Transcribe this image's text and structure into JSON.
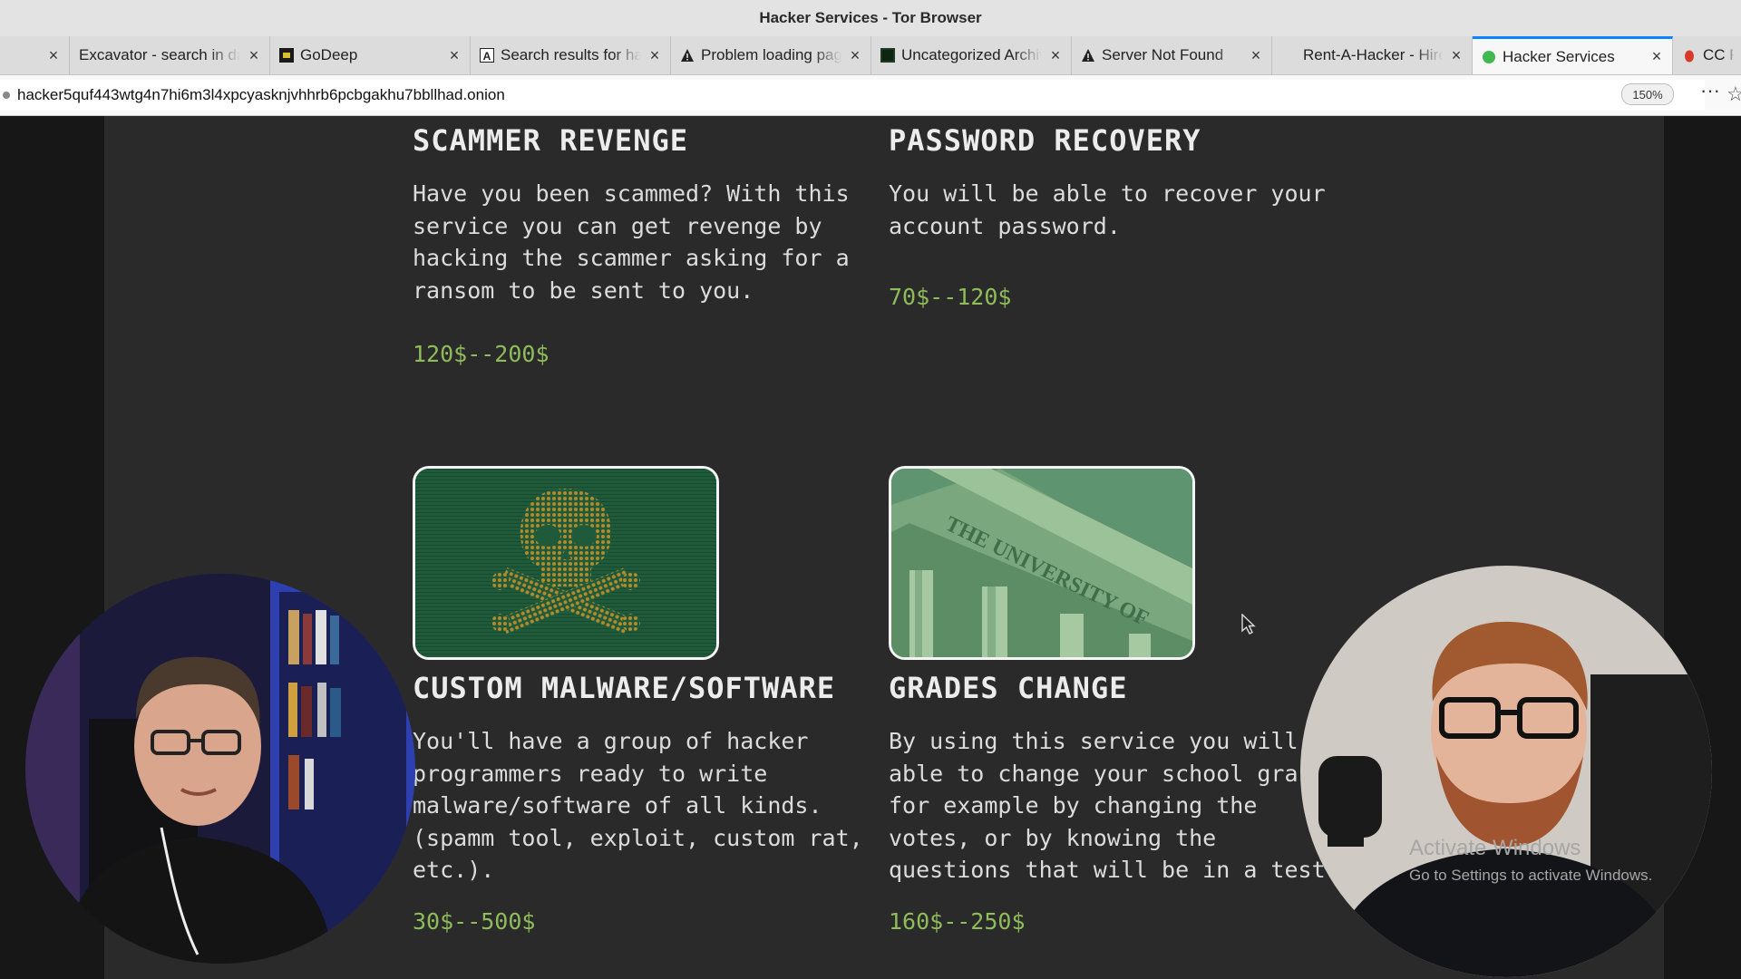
{
  "window": {
    "title": "Hacker Services - Tor Browser"
  },
  "tabs": [
    {
      "label": "",
      "favicon": "none",
      "active": false
    },
    {
      "label": "Excavator - search in dark web",
      "favicon": "none",
      "active": false
    },
    {
      "label": "GoDeep",
      "favicon": "godeep-icon",
      "active": false
    },
    {
      "label": "Search results for hacker",
      "favicon": "letter-a-icon",
      "active": false
    },
    {
      "label": "Problem loading page",
      "favicon": "warning-icon",
      "active": false
    },
    {
      "label": "Uncategorized Archives",
      "favicon": "dark-square-icon",
      "active": false
    },
    {
      "label": "Server Not Found",
      "favicon": "warning-icon",
      "active": false
    },
    {
      "label": "Rent-A-Hacker - Hire",
      "favicon": "none",
      "active": false
    },
    {
      "label": "Hacker Services",
      "favicon": "green-dot-icon",
      "active": true
    },
    {
      "label": "CC F",
      "favicon": "red-icon",
      "active": false
    }
  ],
  "tab_close_glyph": "×",
  "address_bar": {
    "url": "hacker5quf443wtg4n7hi6m3l4xpcyasknjvhhrb6pcbgakhu7bbllhad.onion",
    "zoom": "150%"
  },
  "toolbar": {
    "more_glyph": "···",
    "star_glyph": "☆"
  },
  "services": [
    {
      "title": "SCAMMER REVENGE",
      "description": "Have you been scammed? With this service you can get revenge by hacking the scammer asking for a ransom to be sent to you.",
      "price": "120$--200$"
    },
    {
      "title": "PASSWORD RECOVERY",
      "description": "You will be able to recover your account password.",
      "price": "70$--120$"
    },
    {
      "title": "CUSTOM MALWARE/SOFTWARE",
      "description": "You'll have a group of hacker programmers ready to write malware/software of all kinds. (spamm tool, exploit, custom rat, etc.).",
      "price": "30$--500$",
      "image": "skull-crossbones-image"
    },
    {
      "title": "GRADES CHANGE",
      "description": "By using this service you will able to change your school gra for example by changing the votes, or by knowing the questions that will be in a test",
      "price": "160$--250$",
      "image": "university-building-image",
      "image_text": "THE UNIVERSITY OF"
    }
  ],
  "watermark": {
    "title": "Activate Windows",
    "subtitle": "Go to Settings to activate Windows."
  },
  "colors": {
    "price": "#8fbc5a",
    "page_bg": "#2a2a2a",
    "active_tab_accent": "#0a84ff"
  }
}
